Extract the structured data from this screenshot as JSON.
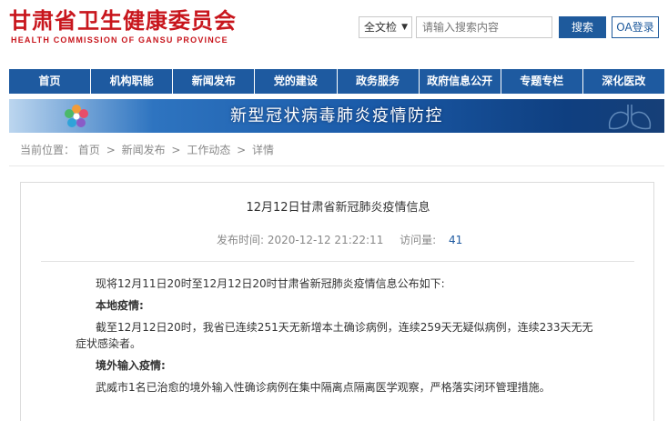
{
  "header": {
    "logo_cn": "甘肃省卫生健康委员会",
    "logo_en": "HEALTH COMMISSION OF GANSU PROVINCE",
    "scope_value": "全文检",
    "search_placeholder": "请输入搜索内容",
    "search_button": "搜索",
    "oa_button": "OA登录"
  },
  "nav": {
    "items": [
      {
        "label": "首页"
      },
      {
        "label": "机构职能"
      },
      {
        "label": "新闻发布"
      },
      {
        "label": "党的建设"
      },
      {
        "label": "政务服务"
      },
      {
        "label": "政府信息公开"
      },
      {
        "label": "专题专栏"
      },
      {
        "label": "深化医改"
      }
    ],
    "color": "#1e5aa0"
  },
  "banner": {
    "title": "新型冠状病毒肺炎疫情防控"
  },
  "breadcrumb": {
    "label": "当前位置：",
    "items": [
      "首页",
      "新闻发布",
      "工作动态",
      "详情"
    ],
    "separator": ">"
  },
  "article": {
    "title": "12月12日甘肃省新冠肺炎疫情信息",
    "publish_label": "发布时间:",
    "publish_time": "2020-12-12 21:22:11",
    "views_label": "访问量:",
    "views": "41",
    "intro": "现将12月11日20时至12月12日20时甘肃省新冠肺炎疫情信息公布如下:",
    "local_heading": "本地疫情:",
    "local_text": "截至12月12日20时，我省已连续251天无新增本土确诊病例，连续259天无疑似病例，连续233天无无症状感染者。",
    "imported_heading": "境外输入疫情:",
    "imported_text": "武威市1名已治愈的境外输入性确诊病例在集中隔离点隔离医学观察，严格落实闭环管理措施。"
  },
  "colors": {
    "brand_red": "#c8161d",
    "nav_blue": "#1e5aa0",
    "button_blue": "#1e5a9c"
  }
}
